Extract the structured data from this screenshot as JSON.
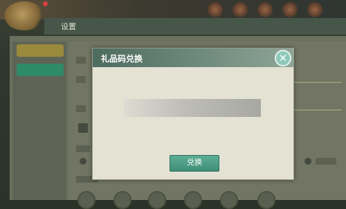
{
  "settings": {
    "title": "设置"
  },
  "dialog": {
    "title": "礼品码兑换",
    "close_symbol": "✕",
    "code_input": {
      "value": "",
      "placeholder": ""
    },
    "redeem_label": "兑换"
  },
  "colors": {
    "dialog_header": "#4d6b5f",
    "redeem_button": "#3e8f76",
    "close_button": "#8ec9b8",
    "dialog_body": "#e4e2d3"
  }
}
